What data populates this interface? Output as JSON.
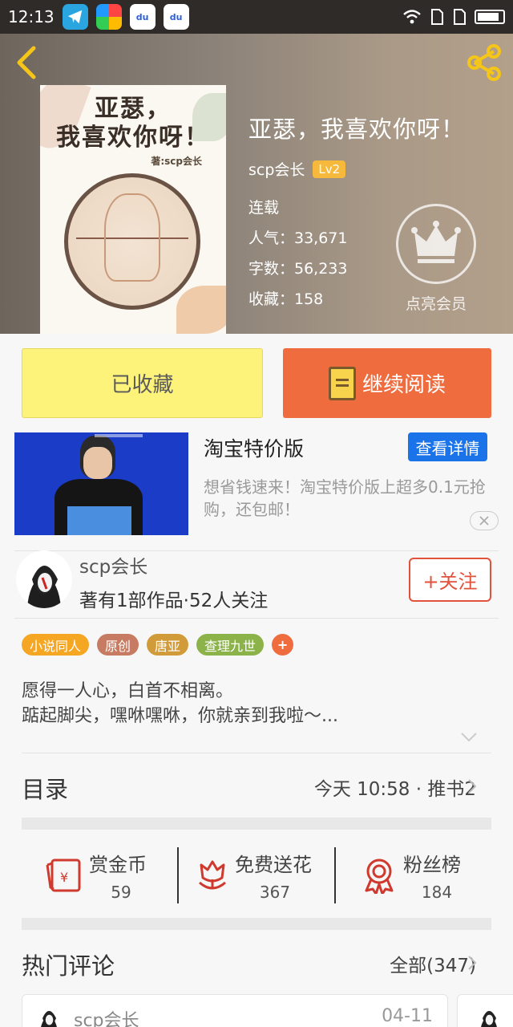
{
  "status_bar": {
    "time": "12:13",
    "app_icons": [
      "telegram-icon",
      "browser-icon",
      "baidu-icon",
      "baidu-icon"
    ]
  },
  "book": {
    "title": "亚瑟，我喜欢你呀！",
    "author": "scp会长",
    "level": "Lv2",
    "status": "连载",
    "popularity": "人气：33,671",
    "word_count": "字数：56,233",
    "favorites": "收藏：158",
    "cover_title_line1": "亚瑟，",
    "cover_title_line2": "我喜欢你呀！",
    "cover_author": "著:scp会长"
  },
  "vip": {
    "label": "点亮会员"
  },
  "actions": {
    "collected": "已收藏",
    "continue_reading": "继续阅读"
  },
  "ad": {
    "title": "淘宝特价版",
    "detail_button": "查看详情",
    "description": "想省钱速来！淘宝特价版上超多0.1元抢购，还包邮！"
  },
  "author_card": {
    "name": "scp会长",
    "summary": "著有1部作品·52人关注",
    "follow_button": "+关注"
  },
  "tags": [
    {
      "label": "小说同人",
      "color": "#f5a623"
    },
    {
      "label": "原创",
      "color": "#c77b62"
    },
    {
      "label": "唐亚",
      "color": "#d29b3a"
    },
    {
      "label": "查理九世",
      "color": "#8cb34a"
    }
  ],
  "tag_add": "+",
  "intro": {
    "line1": "愿得一人心，白首不相离。",
    "line2": "踮起脚尖，嘿咻嘿咻，你就亲到我啦～..."
  },
  "toc": {
    "label": "目录",
    "update": "今天 10:58 · 推书2"
  },
  "stats": [
    {
      "label": "赏金币",
      "value": "59"
    },
    {
      "label": "免费送花",
      "value": "367"
    },
    {
      "label": "粉丝榜",
      "value": "184"
    }
  ],
  "comments": {
    "label": "热门评论",
    "all": "全部(347)",
    "first": {
      "name": "scp会长",
      "date": "04-11"
    }
  },
  "colors": {
    "accent": "#ef6c3f",
    "collected": "#fdf27a",
    "ad_button": "#1a73e8",
    "follow": "#e2513b"
  }
}
